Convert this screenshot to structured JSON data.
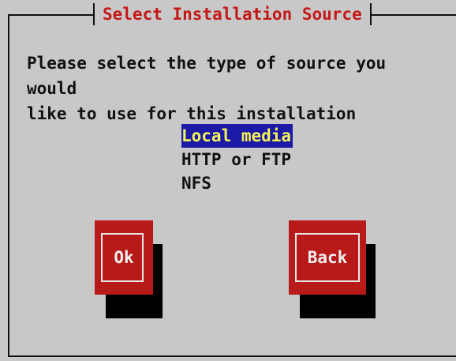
{
  "dialog": {
    "title": "Select Installation Source",
    "prompt": "Please select the type of source you would\nlike to use for this installation"
  },
  "source_list": {
    "items": [
      {
        "label": "Local media",
        "selected": true
      },
      {
        "label": "HTTP or FTP",
        "selected": false
      },
      {
        "label": "NFS",
        "selected": false
      }
    ]
  },
  "buttons": {
    "ok_label": "Ok",
    "back_label": "Back"
  },
  "colors": {
    "background": "#c8c8c8",
    "title_text": "#c41818",
    "selection_bg": "#1a1aa6",
    "selection_text": "#f4f456",
    "button_bg": "#b81a1a",
    "button_text": "#f0f0f0"
  }
}
